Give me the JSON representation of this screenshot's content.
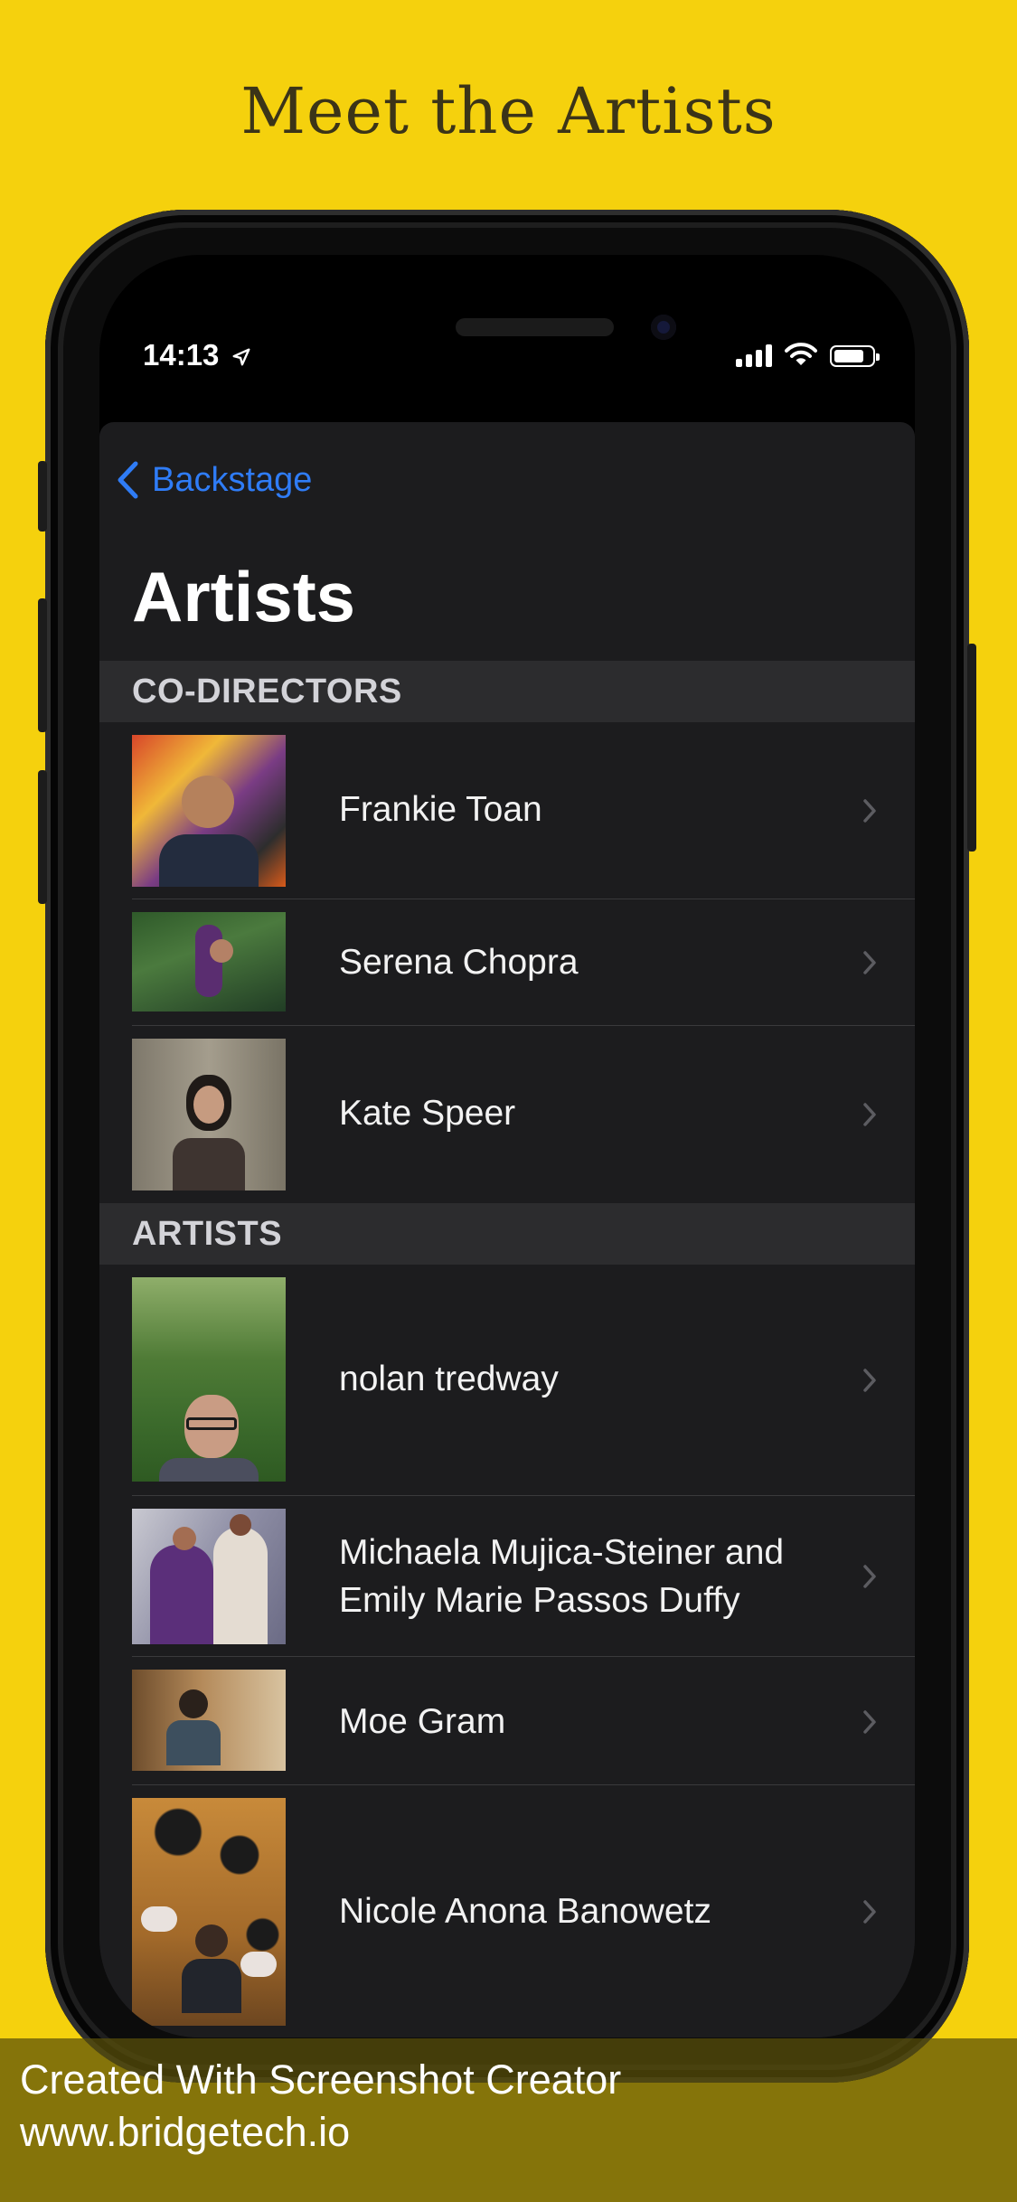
{
  "headline": "Meet the Artists",
  "status_bar": {
    "time": "14:13"
  },
  "nav": {
    "back_label": "Backstage",
    "title": "Artists"
  },
  "sections": [
    {
      "header": "CO-DIRECTORS",
      "items": [
        {
          "name": "Frankie Toan"
        },
        {
          "name": "Serena Chopra"
        },
        {
          "name": "Kate Speer"
        }
      ]
    },
    {
      "header": "ARTISTS",
      "items": [
        {
          "name": "nolan tredway"
        },
        {
          "name": "Michaela Mujica-Steiner and Emily Marie Passos Duffy"
        },
        {
          "name": "Moe Gram"
        },
        {
          "name": "Nicole Anona Banowetz"
        }
      ]
    }
  ],
  "footer": {
    "line1": "Created With Screenshot Creator",
    "line2": "www.bridgetech.io"
  },
  "colors": {
    "background": "#F5D10D",
    "accent": "#2F7CF6",
    "list_bg": "#1C1C1E",
    "section_bg": "#2C2C2E"
  }
}
